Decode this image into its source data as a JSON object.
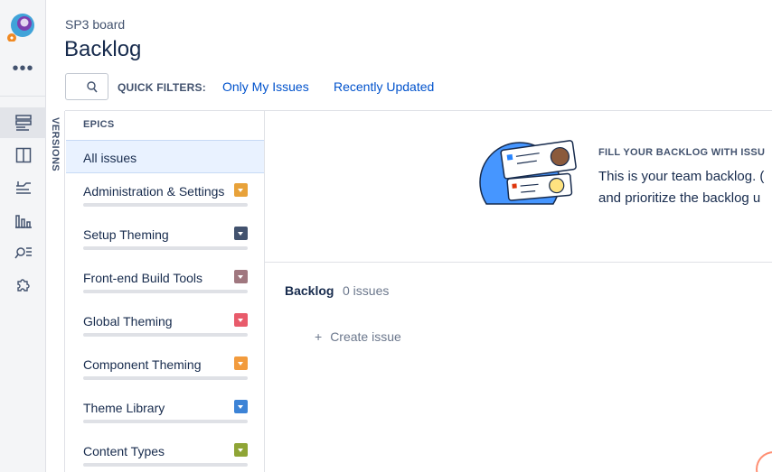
{
  "header": {
    "project": "SP3 board",
    "title": "Backlog"
  },
  "quick_filters": {
    "label": "QUICK FILTERS:",
    "items": [
      "Only My Issues",
      "Recently Updated"
    ]
  },
  "versions_label": "VERSIONS",
  "epics": {
    "heading": "EPICS",
    "all_issues": "All issues",
    "items": [
      {
        "label": "Administration & Settings",
        "color": "#e8a23a"
      },
      {
        "label": "Setup Theming",
        "color": "#42526e"
      },
      {
        "label": "Front-end Build Tools",
        "color": "#a0777f"
      },
      {
        "label": "Global Theming",
        "color": "#e85b6b"
      },
      {
        "label": "Component Theming",
        "color": "#f29b3d"
      },
      {
        "label": "Theme Library",
        "color": "#3c83d6"
      },
      {
        "label": "Content Types",
        "color": "#8fa536"
      }
    ]
  },
  "empty_state": {
    "heading": "FILL YOUR BACKLOG WITH ISSU",
    "line1": "This is your team backlog. (",
    "line2": "and prioritize the backlog u"
  },
  "backlog": {
    "label": "Backlog",
    "count": "0 issues",
    "create_label": "Create issue",
    "create_icon": "plus-icon"
  },
  "nav_icons": [
    "app-logo-icon",
    "more-icon",
    "backlog-icon",
    "board-icon",
    "releases-icon",
    "reports-icon",
    "issues-search-icon",
    "addons-icon"
  ],
  "colors": {
    "link": "#0052cc",
    "rail_bg": "#f4f5f7",
    "selected_bg": "#e9f2ff"
  }
}
